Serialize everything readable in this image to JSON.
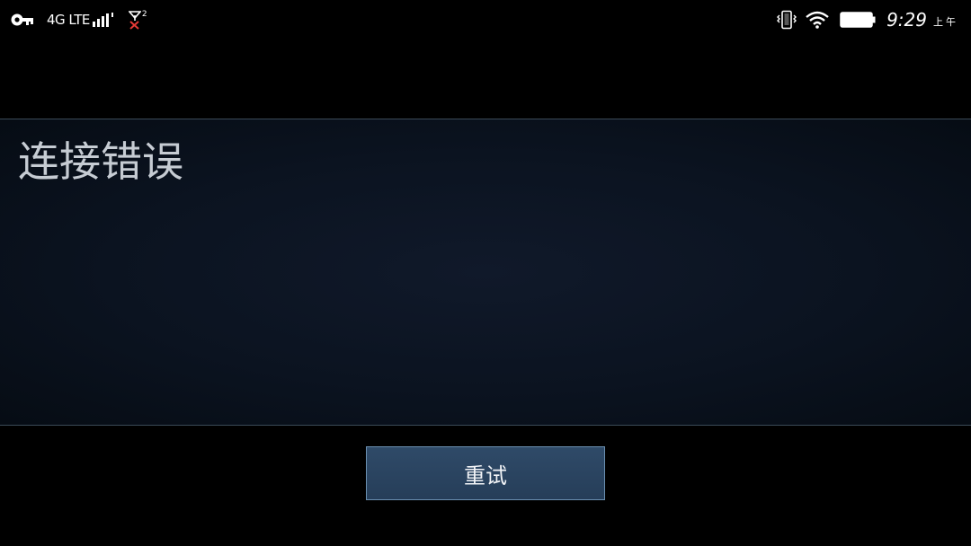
{
  "status_bar": {
    "network_label": "4G LTE",
    "sim_badge": "2",
    "time": "9:29",
    "ampm": "上午",
    "icons": [
      "vpn-key-icon",
      "signal-strength-icon",
      "no-sim-icon",
      "vibrate-icon",
      "wifi-icon",
      "battery-icon"
    ]
  },
  "dialog": {
    "title": "连接错误",
    "retry_label": "重试"
  },
  "colors": {
    "background": "#000000",
    "panel": "#0b1320",
    "panel_border": "#3b4a58",
    "button": "#2b4462",
    "button_border": "#6a8fb0",
    "title_text": "#c6ccd3",
    "no_sim_x": "#e53935"
  }
}
